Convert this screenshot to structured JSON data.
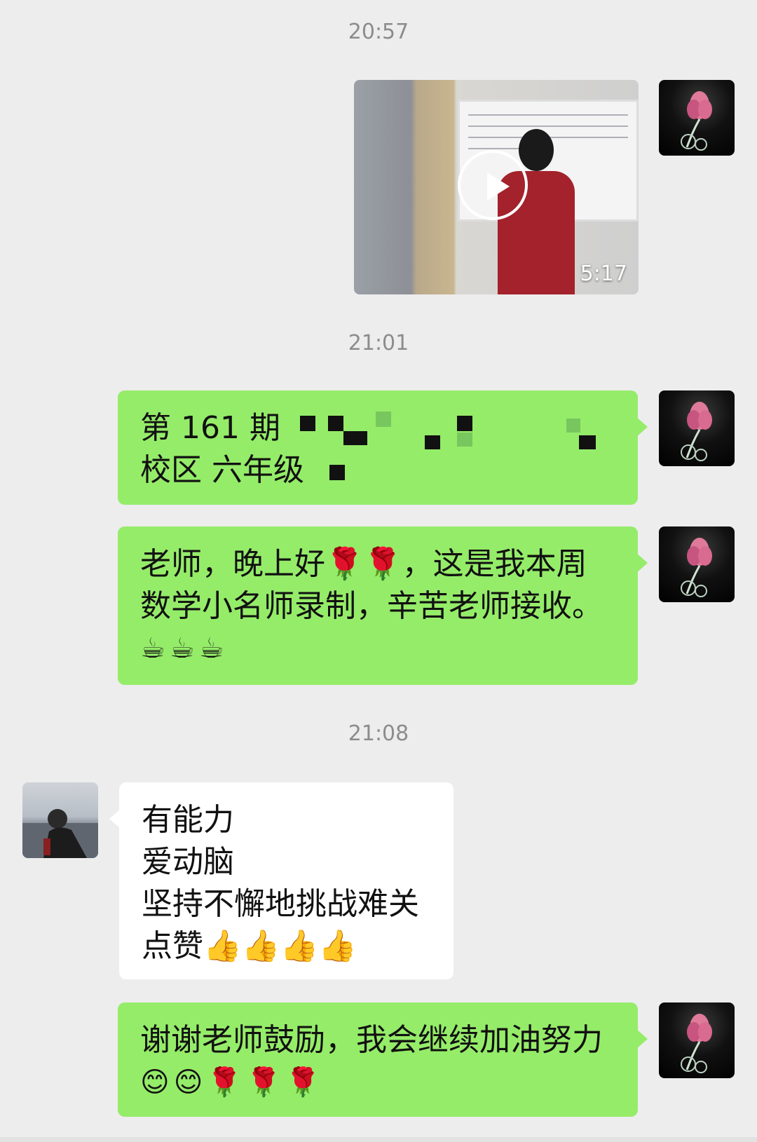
{
  "chat": {
    "timestamps": [
      "20:57",
      "21:01",
      "21:08"
    ],
    "video": {
      "duration": "5:17"
    },
    "messages": [
      {
        "from": "me",
        "lines": [
          "第 161 期 ",
          "校区  六年级"
        ]
      },
      {
        "from": "me",
        "lines": [
          "老师，晚上好🌹🌹，这是我本周",
          "数学小名师录制，辛苦老师接收。",
          "☕☕☕"
        ]
      },
      {
        "from": "other",
        "lines": [
          "有能力",
          "爱动脑",
          "坚持不懈地挑战难关",
          "点赞👍👍👍👍"
        ]
      },
      {
        "from": "me",
        "lines": [
          "谢谢老师鼓励，我会继续加油努力",
          "😊😊🌹🌹🌹"
        ]
      }
    ]
  },
  "avatars": {
    "me": "lotus-avatar-icon",
    "other": "person-avatar-icon"
  },
  "colors": {
    "background": "#ededed",
    "my_bubble": "#95ec69",
    "other_bubble": "#ffffff",
    "timestamp": "#8c8c8c"
  }
}
